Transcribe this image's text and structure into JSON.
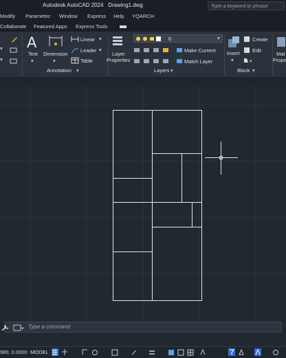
{
  "app": {
    "title": "Autodesk AutoCAD 2024",
    "document": "Drawing1.dwg"
  },
  "search": {
    "placeholder": "Type a keyword or phrase"
  },
  "menu": [
    "Modify",
    "Parametric",
    "Window",
    "Express",
    "Help",
    "YQARCH"
  ],
  "tabs": [
    "Collaborate",
    "Featured Apps",
    "Express Tools"
  ],
  "ribbon": {
    "annotation": {
      "panel_label": "Annotation",
      "text": "Text",
      "dimension": "Dimension",
      "linear": "Linear",
      "leader": "Leader",
      "table": "Table"
    },
    "layers": {
      "panel_label": "Layers",
      "layer_properties_line1": "Layer",
      "layer_properties_line2": "Properties",
      "current_layer": "0",
      "make_current": "Make Current",
      "match_layer": "Match Layer"
    },
    "block": {
      "panel_label": "Block",
      "insert": "Insert",
      "create": "Create",
      "edit": "Edit"
    },
    "partial": {
      "line1": "Mat",
      "line2": "Prope"
    }
  },
  "command_line": {
    "placeholder": "Type a command"
  },
  "status": {
    "coords": "980, 0.0000",
    "model": "MODEL"
  },
  "colors": {
    "background": "#212830",
    "ribbon": "#2b323b",
    "lines": "#e6e8ea",
    "accent": "#2f6fd6"
  },
  "icons": [
    "pencil-icon",
    "text-icon",
    "dimension-icon",
    "layer-properties-icon",
    "insert-block-icon",
    "wrench-icon",
    "grid-icon",
    "snap-icon",
    "osnap-icon"
  ]
}
